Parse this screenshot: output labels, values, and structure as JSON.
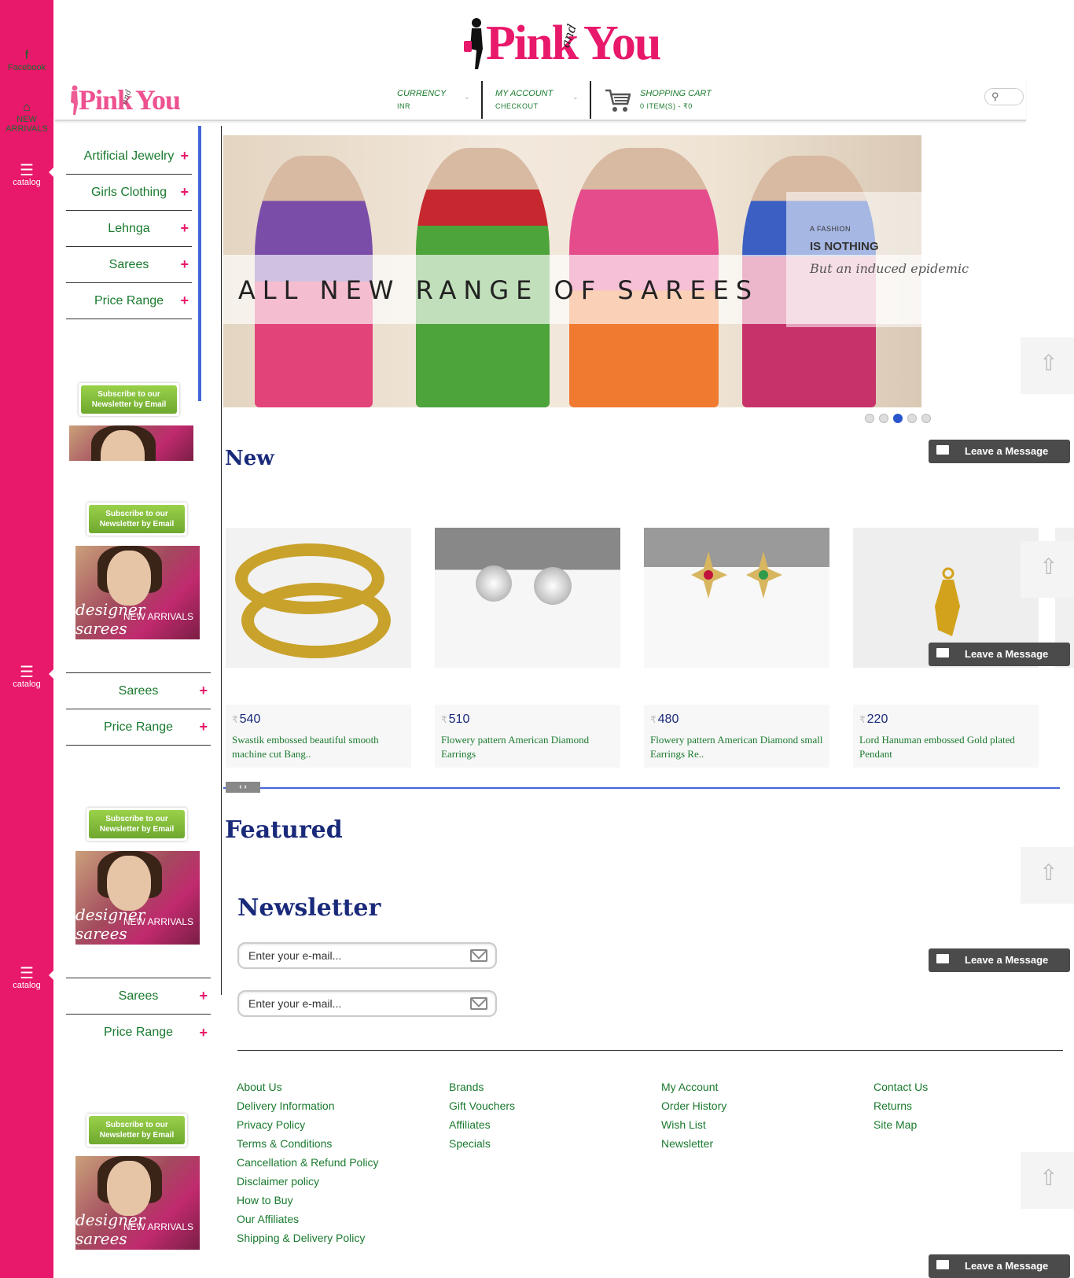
{
  "rail": {
    "facebook": "Facebook",
    "new_arrivals": "NEW ARRIVALS",
    "catalog": "catalog"
  },
  "brand": {
    "pink": "Pink",
    "and": "and",
    "you": "You"
  },
  "header": {
    "currency_label": "CURRENCY",
    "currency_value": "INR",
    "account_label": "MY ACCOUNT",
    "account_sub": "CHECKOUT",
    "cart_label": "SHOPPING CART",
    "cart_value": "0 ITEM(S) - ₹0"
  },
  "menu_primary": [
    {
      "label": "Artificial Jewelry"
    },
    {
      "label": "Girls Clothing"
    },
    {
      "label": "Lehnga"
    },
    {
      "label": "Sarees"
    },
    {
      "label": "Price Range"
    }
  ],
  "menu_secondary": [
    {
      "label": "Sarees"
    },
    {
      "label": "Price Range"
    }
  ],
  "subscribe": {
    "line1": "Subscribe to our",
    "line2": "Newsletter by Email"
  },
  "promo": {
    "line1": "NEW ARRIVALS",
    "line2": "designer sarees"
  },
  "hero": {
    "band_text": "ALL NEW RANGE OF SAREES",
    "tag1": "A FASHION",
    "tag2": "IS NOTHING",
    "tag3": "But an induced epidemic"
  },
  "sections": {
    "new": "New",
    "featured": "Featured",
    "newsletter": "Newsletter"
  },
  "products": [
    {
      "currency": "₹",
      "price": "540",
      "name": "Swastik embossed beautiful smooth machine cut Bang.."
    },
    {
      "currency": "₹",
      "price": "510",
      "name": "Flowery pattern American Diamond Earrings"
    },
    {
      "currency": "₹",
      "price": "480",
      "name": "Flowery pattern American Diamond small Earrings Re.."
    },
    {
      "currency": "₹",
      "price": "220",
      "name": "Lord Hanuman embossed Gold plated Pendant"
    }
  ],
  "newsletter": {
    "placeholder": "Enter your e-mail..."
  },
  "leave_message": "Leave a Message",
  "footer": {
    "col1": [
      "About Us",
      "Delivery Information",
      "Privacy Policy",
      "Terms & Conditions",
      "Cancellation & Refund Policy",
      "Disclaimer policy",
      "How to Buy",
      "Our Affiliates",
      "Shipping & Delivery Policy"
    ],
    "col2": [
      "Brands",
      "Gift Vouchers",
      "Affiliates",
      "Specials"
    ],
    "col3": [
      "My Account",
      "Order History",
      "Wish List",
      "Newsletter"
    ],
    "col4": [
      "Contact Us",
      "Returns",
      "Site Map"
    ]
  },
  "colors": {
    "brand_pink": "#e8186a",
    "link_green": "#1a7a2e",
    "heading_navy": "#1a2a7a",
    "accent_blue": "#4466dd"
  },
  "slider": {
    "active_index": 2,
    "count": 5
  }
}
